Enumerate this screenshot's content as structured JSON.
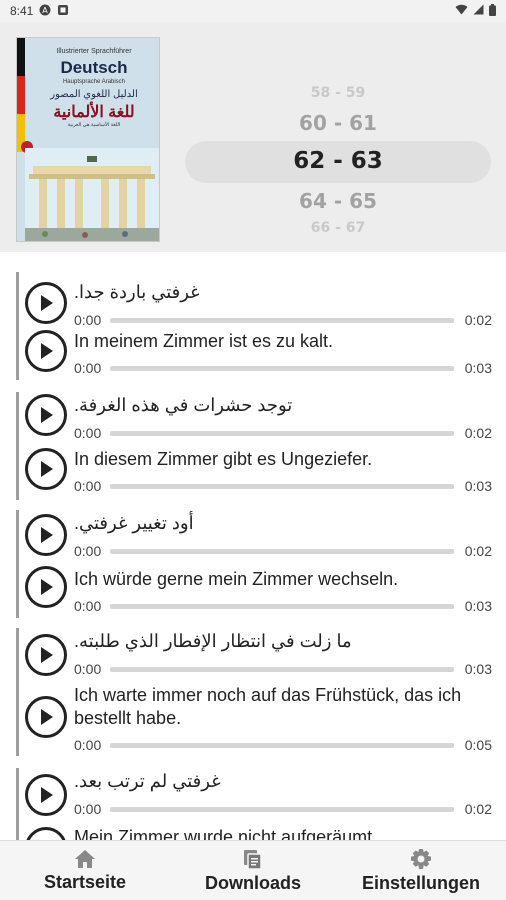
{
  "status_bar": {
    "time": "8:41",
    "icons": [
      "a-icon",
      "media-icon",
      "wifi-icon",
      "signal-icon",
      "battery-icon"
    ]
  },
  "book": {
    "series": "Illustrierter Sprachführer",
    "title": "Deutsch",
    "subtitle": "Hauptsprache Arabisch",
    "arabic_line1": "الدليل اللغوي المصور",
    "arabic_line2": "للغة الألمانية",
    "arabic_line3": "اللغة الأساسية هي العربية"
  },
  "page_picker": {
    "items": [
      "58 - 59",
      "60 - 61",
      "62 - 63",
      "64 - 65",
      "66 - 67"
    ],
    "selected": "62 - 63"
  },
  "phrases": [
    {
      "arabic": {
        "text": "غرفتي باردة جدا.",
        "current": "0:00",
        "duration": "0:02"
      },
      "german": {
        "text": "In meinem Zimmer ist es zu kalt.",
        "current": "0:00",
        "duration": "0:03"
      }
    },
    {
      "arabic": {
        "text": "توجد حشرات في هذه الغرفة.",
        "current": "0:00",
        "duration": "0:02"
      },
      "german": {
        "text": "In diesem Zimmer gibt es Ungeziefer.",
        "current": "0:00",
        "duration": "0:03"
      }
    },
    {
      "arabic": {
        "text": "أود تغيير غرفتي.",
        "current": "0:00",
        "duration": "0:02"
      },
      "german": {
        "text": "Ich würde gerne mein Zimmer wechseln.",
        "current": "0:00",
        "duration": "0:03"
      }
    },
    {
      "arabic": {
        "text": "ما زلت في انتظار الإفطار الذي طلبته.",
        "current": "0:00",
        "duration": "0:03"
      },
      "german": {
        "text": "Ich warte immer noch auf das Frühstück, das ich bestellt habe.",
        "current": "0:00",
        "duration": "0:05"
      }
    },
    {
      "arabic": {
        "text": "غرفتي لم ترتب بعد.",
        "current": "0:00",
        "duration": "0:02"
      },
      "german": {
        "text": "Mein Zimmer wurde nicht aufgeräumt.",
        "current": "",
        "duration": ""
      }
    }
  ],
  "nav": {
    "home": {
      "label": "Startseite",
      "icon": "home-icon"
    },
    "downloads": {
      "label": "Downloads",
      "icon": "downloads-icon"
    },
    "settings": {
      "label": "Einstellungen",
      "icon": "gear-icon"
    }
  }
}
